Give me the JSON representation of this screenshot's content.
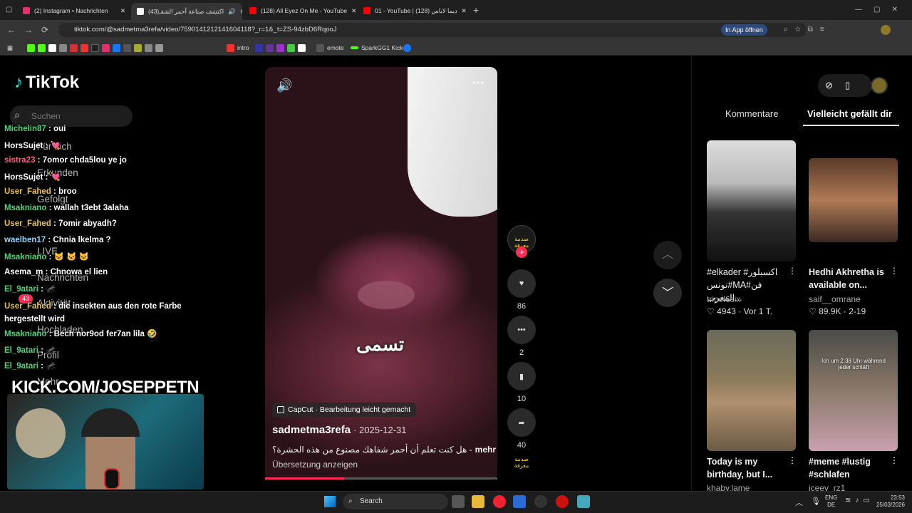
{
  "browser": {
    "tabs": [
      {
        "label": "(2) Instagram • Nachrichten",
        "color": "#e1306c"
      },
      {
        "label": "اكتشف صناعة أحمر الشفـ(43)",
        "color": "#111"
      },
      {
        "label": "(128) All Eyez On Me - YouTube",
        "color": "#ff0000"
      },
      {
        "label": "01 - YouTube | (128) ديما لاباس",
        "color": "#ff0000"
      }
    ],
    "new_tab": "+",
    "url": "tiktok.com/@sadmetma3refa/video/7590141212141604118?_r=1&_t=ZS-94zbD6RqooJ",
    "open_app": "In App öffnen",
    "bookmarks": [
      "intro",
      "emote",
      "SparkGG1 Kick"
    ]
  },
  "tiktok": {
    "logo": "TikTok",
    "search_placeholder": "Suchen",
    "nav": [
      "Für dich",
      "Erkunden",
      "Gefolgt",
      "LIVE",
      "Nachrichten",
      "Aktivität",
      "Hochladen",
      "Profil",
      "Mehr"
    ],
    "activity_badge": "43"
  },
  "chat": [
    {
      "user": "Michelin87",
      "msg": "oui",
      "color": "#4fd37a"
    },
    {
      "user": "HorsSujet",
      "msg": "💘",
      "color": "#fff"
    },
    {
      "user": "sistra23",
      "msg": "7omor chda5lou ye jo",
      "color": "#ff5f7a"
    },
    {
      "user": "HorsSujet",
      "msg": "💘",
      "color": "#fff"
    },
    {
      "user": "User_Fahed",
      "msg": "broo",
      "color": "#e8c34a"
    },
    {
      "user": "Msakniano",
      "msg": "wallah t3ebt 3alaha",
      "color": "#4fd37a"
    },
    {
      "user": "User_Fahed",
      "msg": "7omir abyadh?",
      "color": "#e8c34a"
    },
    {
      "user": "waelben17",
      "msg": "Chnia lkelma ?",
      "color": "#8ad8ff"
    },
    {
      "user": "Msakniano",
      "msg": "🐱 🐱 🐱",
      "color": "#4fd37a"
    },
    {
      "user": "Asema_m",
      "msg": "Chnowa el lien",
      "color": "#ffffff"
    },
    {
      "user": "El_9atari",
      "msg": "🦟",
      "color": "#4fd37a"
    },
    {
      "user": "User_Fahed",
      "msg": "die insekten aus den rote Farbe hergestellt wird",
      "color": "#e8c34a"
    },
    {
      "user": "Msakniano",
      "msg": "Bech nor9od fer7an lila 🤣",
      "color": "#4fd37a"
    },
    {
      "user": "El_9atari",
      "msg": "🦟",
      "color": "#4fd37a"
    },
    {
      "user": "El_9atari",
      "msg": "🦟",
      "color": "#4fd37a"
    }
  ],
  "stream_overlay": "KICK.COM/JOSEPPETN",
  "video": {
    "caption_overlay": "تسمى",
    "capcut": "CapCut · Bearbeitung leicht gemacht",
    "author": "sadmetma3refa",
    "date": "· 2025-12-31",
    "description": "هل كنت تعلم أن أحمر شفاهك مصنوع من هذه الحشرة؟ -",
    "more": "mehr",
    "translate": "Übersetzung anzeigen",
    "likes": "86",
    "comments": "2",
    "saves": "10",
    "shares": "40",
    "avatar_label": "صدمة معرفة"
  },
  "sidebar": {
    "tab_comments": "Kommentare",
    "tab_suggested": "Vielleicht gefällt dir",
    "cards": [
      {
        "title": "#elkader #اكسبلور تونس#MA#فن المغرب...",
        "user": "tripel6six",
        "stat": "♡ 4943 · Vor 1 T."
      },
      {
        "title": "Hedhi Akhretha is available on...",
        "user": "saif__omrane",
        "stat": "♡ 89.9K · 2-19"
      },
      {
        "title": "Today is my birthday, but I...",
        "user": "khaby.lame",
        "stat": ""
      },
      {
        "title": "#meme #lustig #schlafen",
        "user": "iceev_rz1",
        "stat": ""
      }
    ],
    "card4_overlay": "Ich um 2:38 Uhr während jeder schläft"
  },
  "taskbar": {
    "search": "Search",
    "lang1": "ENG",
    "lang2": "DE",
    "time": "23:53",
    "date": "25/03/2026"
  }
}
